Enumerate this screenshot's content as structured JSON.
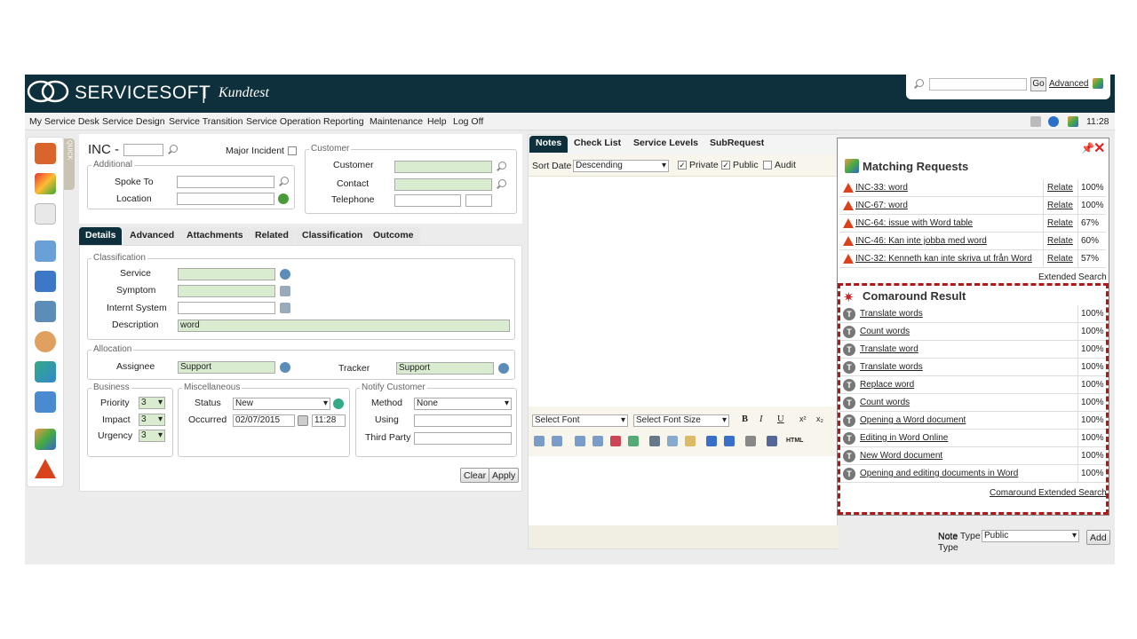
{
  "header": {
    "brand": "SERVICESOFT",
    "separator": "|",
    "environment": "Kundtest",
    "search_go": "Go",
    "search_advanced": "Advanced"
  },
  "menu": [
    "My Service Desk",
    "Service Design",
    "Service Transition",
    "Service Operation",
    "Reporting",
    "Maintenance",
    "Help",
    "Log Off"
  ],
  "clock": "11:28",
  "quick": "QUICK",
  "form": {
    "inc_label": "INC -",
    "major_incident": "Major Incident",
    "additional": "Additional",
    "spoke_to": "Spoke To",
    "location": "Location",
    "customer": "Customer",
    "customer_lbl": "Customer",
    "contact": "Contact",
    "telephone": "Telephone"
  },
  "tabs": [
    "Details",
    "Advanced",
    "Attachments",
    "Related",
    "Classification",
    "Outcome"
  ],
  "classification": {
    "legend": "Classification",
    "service": "Service",
    "symptom": "Symptom",
    "internal_system": "Internt System",
    "description": "Description",
    "description_value": "word"
  },
  "allocation": {
    "legend": "Allocation",
    "assignee": "Assignee",
    "assignee_value": "Support",
    "tracker": "Tracker",
    "tracker_value": "Support"
  },
  "business": {
    "legend": "Business",
    "priority": "Priority",
    "priority_value": "3",
    "impact": "Impact",
    "impact_value": "3",
    "urgency": "Urgency",
    "urgency_value": "3"
  },
  "misc": {
    "legend": "Miscellaneous",
    "status": "Status",
    "status_value": "New",
    "occurred": "Occurred",
    "date": "02/07/2015",
    "time": "11:28"
  },
  "notify": {
    "legend": "Notify Customer",
    "method": "Method",
    "method_value": "None",
    "using": "Using",
    "third_party": "Third Party"
  },
  "buttons": {
    "clear": "Clear",
    "apply": "Apply",
    "add": "Add"
  },
  "notes": {
    "tabs": [
      "Notes",
      "Check List",
      "Service Levels",
      "SubRequest"
    ],
    "sort_date": "Sort Date",
    "sort_value": "Descending",
    "private": "Private",
    "public": "Public",
    "audit": "Audit",
    "font": "Select Font",
    "font_size": "Select Font Size",
    "note_type": "Note Type",
    "note_type_value": "Public",
    "html": "HTML"
  },
  "matching": {
    "title": "Matching Requests",
    "relate": "Relate",
    "extended": "Extended Search",
    "rows": [
      {
        "id": "INC-33: word",
        "pct": "100%"
      },
      {
        "id": "INC-67: word",
        "pct": "100%"
      },
      {
        "id": "INC-64: issue with Word table",
        "pct": "67%"
      },
      {
        "id": "INC-46: Kan inte jobba med word",
        "pct": "60%"
      },
      {
        "id": "INC-32: Kenneth kan inte skriva ut från Word",
        "pct": "57%"
      }
    ]
  },
  "comaround": {
    "title": "Comaround Result",
    "extended": "Comaround Extended Search",
    "rows": [
      {
        "title": "Translate words",
        "pct": "100%"
      },
      {
        "title": "Count words",
        "pct": "100%"
      },
      {
        "title": "Translate word",
        "pct": "100%"
      },
      {
        "title": "Translate words",
        "pct": "100%"
      },
      {
        "title": "Replace word",
        "pct": "100%"
      },
      {
        "title": "Count words",
        "pct": "100%"
      },
      {
        "title": "Opening a Word document",
        "pct": "100%"
      },
      {
        "title": "Editing in Word Online",
        "pct": "100%"
      },
      {
        "title": "New Word document",
        "pct": "100%"
      },
      {
        "title": "Opening and editing documents in Word",
        "pct": "100%"
      }
    ]
  }
}
